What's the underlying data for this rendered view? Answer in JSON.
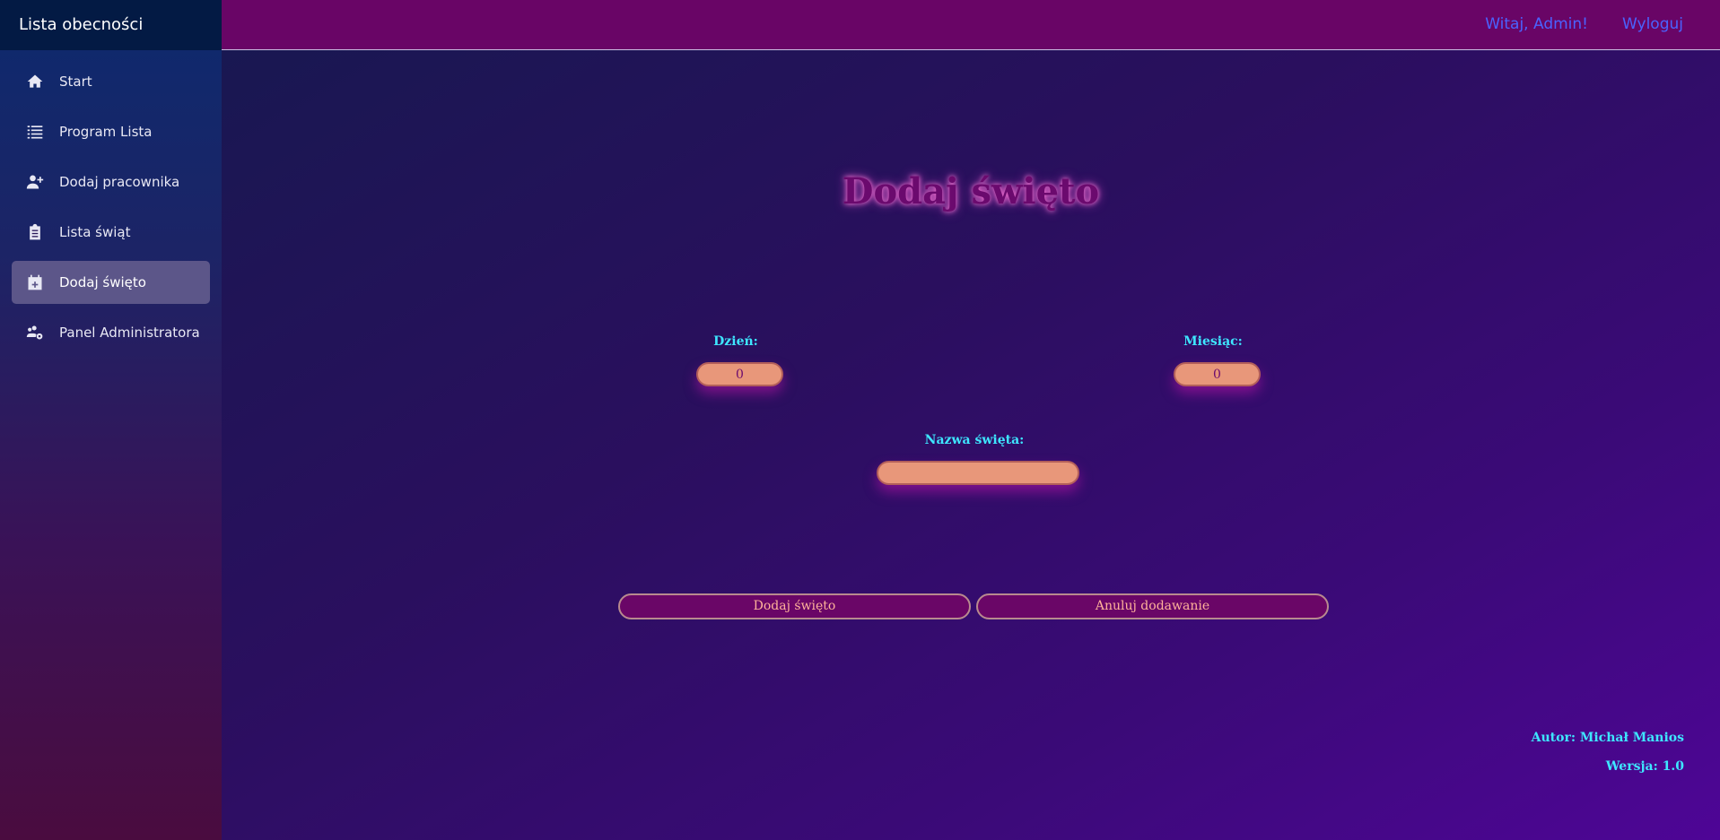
{
  "sidebar": {
    "title": "Lista obecności",
    "items": [
      {
        "label": "Start",
        "icon": "home-icon",
        "active": false
      },
      {
        "label": "Program Lista",
        "icon": "list-icon",
        "active": false
      },
      {
        "label": "Dodaj pracownika",
        "icon": "user-plus-icon",
        "active": false
      },
      {
        "label": "Lista świąt",
        "icon": "clipboard-list-icon",
        "active": false
      },
      {
        "label": "Dodaj święto",
        "icon": "calendar-plus-icon",
        "active": true
      },
      {
        "label": "Panel Administratora",
        "icon": "users-cog-icon",
        "active": false
      }
    ]
  },
  "topbar": {
    "greeting": "Witaj, Admin!",
    "logout": "Wyloguj"
  },
  "form": {
    "title": "Dodaj święto",
    "day_label": "Dzień:",
    "day_value": "0",
    "month_label": "Miesiąc:",
    "month_value": "0",
    "name_label": "Nazwa święta:",
    "name_value": "",
    "submit_label": "Dodaj święto",
    "cancel_label": "Anuluj dodawanie"
  },
  "footer": {
    "author": "Autor: Michał Manios",
    "version": "Wersja: 1.0"
  },
  "colors": {
    "accent_label": "#3ee6ff",
    "input_bg": "#e8977a",
    "button_bg": "#6a0667",
    "topbar_bg": "#690566",
    "active_nav": "#5c5689",
    "link": "#4a63ff"
  }
}
